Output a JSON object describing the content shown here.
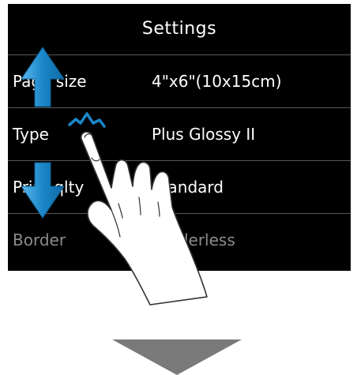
{
  "screen": {
    "title": "Settings",
    "rows": [
      {
        "label": "Page size",
        "value": "4\"x6\"(10x15cm)"
      },
      {
        "label": "Type",
        "value": "Plus Glossy II"
      },
      {
        "label": "Print qlty",
        "value": "Standard"
      },
      {
        "label": "Border",
        "value": "Borderless"
      }
    ]
  },
  "gesture": {
    "icons": [
      "up-arrow-icon",
      "down-arrow-icon",
      "tap-sparkle-icon",
      "pointing-hand-icon"
    ],
    "arrow_color": "#1a86c8"
  },
  "next_step_icon": "down-arrow-icon",
  "next_step_color": "#7a7a7a"
}
